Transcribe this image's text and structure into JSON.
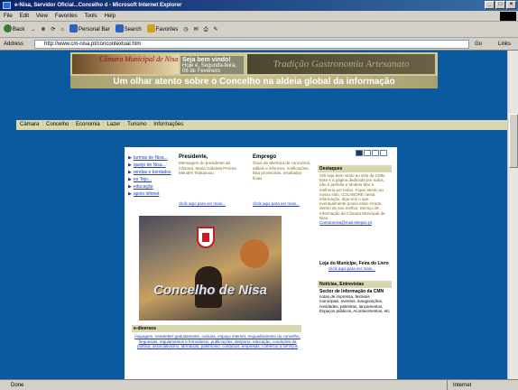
{
  "window": {
    "title": "e-Nisa, Servidor Oficial...Concelho d - Microsoft Internet Explorer"
  },
  "menu": [
    "File",
    "Edit",
    "View",
    "Favorites",
    "Tools",
    "Help"
  ],
  "toolbar": {
    "back": "Back",
    "personal_bar": "Personal Bar",
    "search": "Search",
    "favorites": "Favorites"
  },
  "address": {
    "label": "Address",
    "url": "http://www.cm-nisa.pt/concontextual.htm",
    "go": "Go",
    "links": "Links"
  },
  "status": {
    "text": "Done",
    "zone": "Internet"
  },
  "banner": {
    "logo": "Câmara Municipal de Nisa",
    "welcome_title": "Seja bem vindo!",
    "welcome_text": "Hoje é, Segunda-feira, 06 de Fevereiro",
    "tradicao": "Tradição Gastronomia Artesanato",
    "tagline": "Um olhar atento sobre o Concelho na aldeia global da informação"
  },
  "nav": [
    "Câmara",
    "Concelho",
    "Economia",
    "Lazer",
    "Turismo",
    "Informações"
  ],
  "links": [
    "turmas de Nisa...",
    "queijo de Nisa...",
    "rendas e bordados",
    "no Tejo...",
    "educação",
    "apoio infonet"
  ],
  "presidente": {
    "title": "Presidente,",
    "text": "Mensagem do presidente da Câmara, Maria Gabriela Pereira Mendes Tsukamoto",
    "more": "clicik aqui para ver mais..."
  },
  "emprego": {
    "title": "Emprego",
    "text": "Ônus de abertura de concursos, editais e informes, notificações, lista provisórias, resultados finais",
    "more": "clicik aqui para ver mais..."
  },
  "photo": {
    "label": "Concelho de Nisa"
  },
  "diversos": {
    "title": "e-diversos",
    "text": "mapagem, newsletter gratuitamente, noticias, espaço internet, enquadramento do concelho, freguesias, regulamentos e formulários, publicações, desporto, educação, condições da política, associativismo, farmácias, património, contactos, empresas, comércio a serviços"
  },
  "sidebar": {
    "destaques_title": "Destaques",
    "destaques_text": "Olá seja bem vindo ao sítio da CMN. Este é a página dedicada por todos, não é perfeita e Modelo Mar à melhoria por todos. Fique atento ao nosso sítio, COLABORE nesta informação, digo-nos o que eventualmente possa estar errado, dentro do seu melhor. Serviço de Informação da Câmara Municipal de Nisa",
    "destaques_email": "Camaranisa@mail.telepac.pt",
    "loja_title": "Loja do Munícipe, Feira do Livro",
    "loja_more": "clicik aqui para ver mais...",
    "noticias_title": "Notícias, Entrevistas",
    "noticias_sub": "Sector de Informação da CMN",
    "noticias_text": "notas de imprensa, festivais municipais, eventos, inaugurações, novidades, palestras, lançamentos, Espaços públicos, Acontecimentos, etc"
  }
}
